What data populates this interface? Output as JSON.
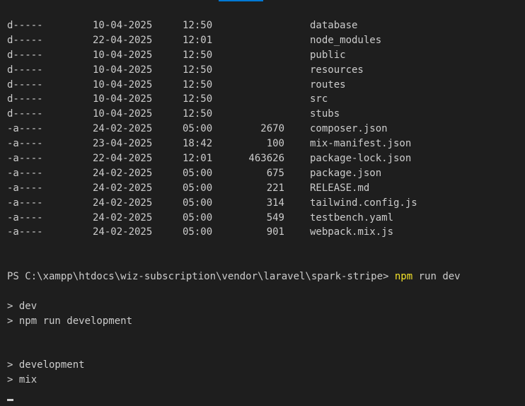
{
  "listing": [
    {
      "mode": "d-----",
      "date": "10-04-2025",
      "time": "12:50",
      "length": "",
      "name": "database"
    },
    {
      "mode": "d-----",
      "date": "22-04-2025",
      "time": "12:01",
      "length": "",
      "name": "node_modules"
    },
    {
      "mode": "d-----",
      "date": "10-04-2025",
      "time": "12:50",
      "length": "",
      "name": "public"
    },
    {
      "mode": "d-----",
      "date": "10-04-2025",
      "time": "12:50",
      "length": "",
      "name": "resources"
    },
    {
      "mode": "d-----",
      "date": "10-04-2025",
      "time": "12:50",
      "length": "",
      "name": "routes"
    },
    {
      "mode": "d-----",
      "date": "10-04-2025",
      "time": "12:50",
      "length": "",
      "name": "src"
    },
    {
      "mode": "d-----",
      "date": "10-04-2025",
      "time": "12:50",
      "length": "",
      "name": "stubs"
    },
    {
      "mode": "-a----",
      "date": "24-02-2025",
      "time": "05:00",
      "length": "2670",
      "name": "composer.json"
    },
    {
      "mode": "-a----",
      "date": "23-04-2025",
      "time": "18:42",
      "length": "100",
      "name": "mix-manifest.json"
    },
    {
      "mode": "-a----",
      "date": "22-04-2025",
      "time": "12:01",
      "length": "463626",
      "name": "package-lock.json"
    },
    {
      "mode": "-a----",
      "date": "24-02-2025",
      "time": "05:00",
      "length": "675",
      "name": "package.json"
    },
    {
      "mode": "-a----",
      "date": "24-02-2025",
      "time": "05:00",
      "length": "221",
      "name": "RELEASE.md"
    },
    {
      "mode": "-a----",
      "date": "24-02-2025",
      "time": "05:00",
      "length": "314",
      "name": "tailwind.config.js"
    },
    {
      "mode": "-a----",
      "date": "24-02-2025",
      "time": "05:00",
      "length": "549",
      "name": "testbench.yaml"
    },
    {
      "mode": "-a----",
      "date": "24-02-2025",
      "time": "05:00",
      "length": "901",
      "name": "webpack.mix.js"
    }
  ],
  "prompt": {
    "path": "PS C:\\xampp\\htdocs\\wiz-subscription\\vendor\\laravel\\spark-stripe> ",
    "command": "npm",
    "args": " run dev"
  },
  "output": {
    "line1": "> dev",
    "line2": "> npm run development",
    "line3": "> development",
    "line4": "> mix"
  },
  "colors": {
    "background": "#1e1e1e",
    "text": "#cccccc",
    "command": "#f2e12a",
    "tab_accent": "#0078d4"
  }
}
